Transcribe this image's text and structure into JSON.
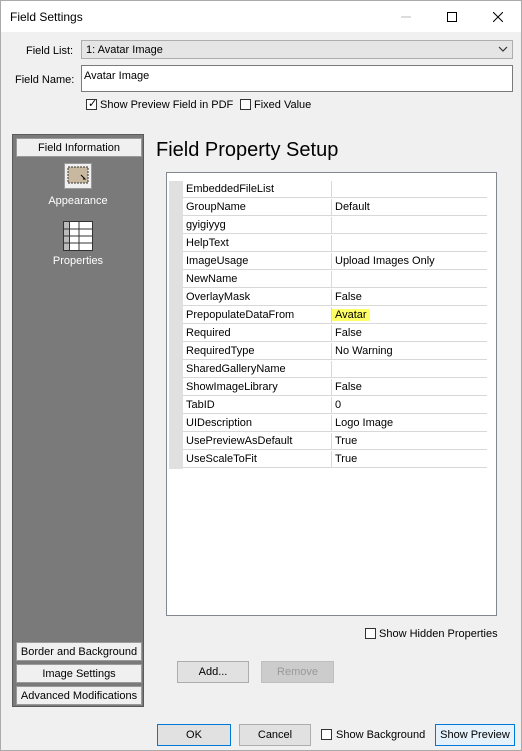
{
  "window": {
    "title": "Field Settings"
  },
  "form": {
    "field_list_label": "Field List:",
    "field_list_value": "1: Avatar Image",
    "field_name_label": "Field Name:",
    "field_name_value": "Avatar Image",
    "show_preview_label": "Show Preview Field in PDF",
    "show_preview_checked": true,
    "fixed_value_label": "Fixed Value",
    "fixed_value_checked": false
  },
  "sidebar": {
    "top_button": "Field Information",
    "items": [
      {
        "label": "Appearance",
        "icon": "appearance-icon"
      },
      {
        "label": "Properties",
        "icon": "properties-grid-icon"
      }
    ],
    "bottom_buttons": [
      "Border and Background",
      "Image Settings",
      "Advanced Modifications"
    ]
  },
  "main": {
    "heading": "Field Property Setup",
    "properties": [
      {
        "name": "EmbeddedFileList",
        "value": ""
      },
      {
        "name": "GroupName",
        "value": "Default"
      },
      {
        "name": "gyigiyyg",
        "value": ""
      },
      {
        "name": "HelpText",
        "value": ""
      },
      {
        "name": "ImageUsage",
        "value": "Upload Images Only"
      },
      {
        "name": "NewName",
        "value": ""
      },
      {
        "name": "OverlayMask",
        "value": "False"
      },
      {
        "name": "PrepopulateDataFrom",
        "value": "Avatar",
        "highlight": true
      },
      {
        "name": "Required",
        "value": "False"
      },
      {
        "name": "RequiredType",
        "value": "No Warning"
      },
      {
        "name": "SharedGalleryName",
        "value": ""
      },
      {
        "name": "ShowImageLibrary",
        "value": "False"
      },
      {
        "name": "TabID",
        "value": "0"
      },
      {
        "name": "UIDescription",
        "value": "Logo Image"
      },
      {
        "name": "UsePreviewAsDefault",
        "value": "True"
      },
      {
        "name": "UseScaleToFit",
        "value": "True"
      }
    ],
    "show_hidden_label": "Show Hidden Properties",
    "add_label": "Add...",
    "remove_label": "Remove"
  },
  "footer": {
    "ok_label": "OK",
    "cancel_label": "Cancel",
    "show_background_label": "Show Background",
    "show_preview_label": "Show Preview"
  },
  "colors": {
    "highlight": "#ffff66",
    "sidebar": "#7a7a7a",
    "accent": "#0078d7"
  }
}
